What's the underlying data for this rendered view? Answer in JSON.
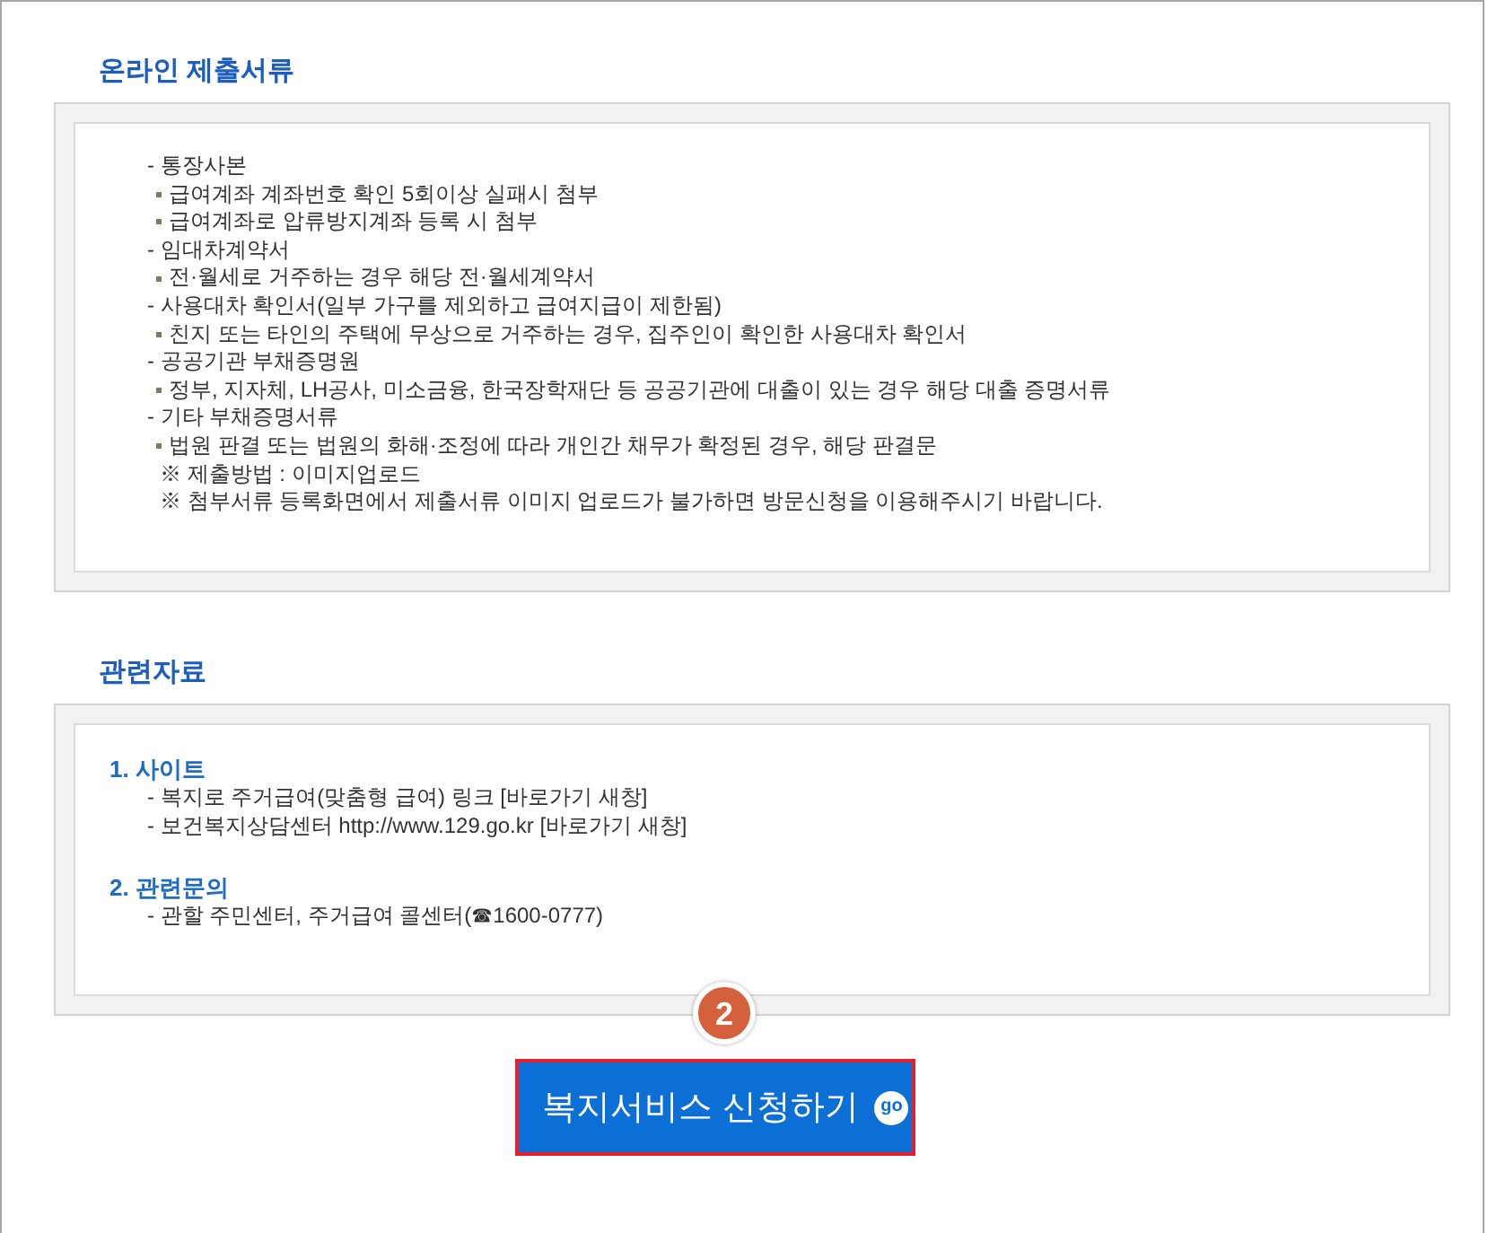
{
  "submission_documents": {
    "title": "온라인 제출서류",
    "lines": [
      {
        "kind": "heading",
        "text": "- 통장사본"
      },
      {
        "kind": "bullet",
        "text": "급여계좌 계좌번호 확인 5회이상 실패시 첨부"
      },
      {
        "kind": "bullet",
        "text": "급여계좌로 압류방지계좌 등록 시 첨부"
      },
      {
        "kind": "heading",
        "text": "- 임대차계약서"
      },
      {
        "kind": "bullet",
        "text": "전·월세로 거주하는 경우 해당 전·월세계약서"
      },
      {
        "kind": "heading",
        "text": "- 사용대차 확인서(일부 가구를 제외하고 급여지급이 제한됨)"
      },
      {
        "kind": "bullet",
        "text": "친지 또는 타인의 주택에 무상으로 거주하는 경우, 집주인이 확인한 사용대차 확인서"
      },
      {
        "kind": "heading",
        "text": "- 공공기관 부채증명원"
      },
      {
        "kind": "bullet",
        "text": "정부, 지자체, LH공사, 미소금융, 한국장학재단 등 공공기관에 대출이 있는 경우 해당 대출 증명서류"
      },
      {
        "kind": "heading",
        "text": "- 기타 부채증명서류"
      },
      {
        "kind": "bullet",
        "text": "법원 판결 또는 법원의 화해·조정에 따라 개인간 채무가 확정된 경우, 해당 판결문"
      },
      {
        "kind": "note",
        "text": "※ 제출방법 : 이미지업로드"
      },
      {
        "kind": "note",
        "text": "※ 첨부서류 등록화면에서 제출서류 이미지 업로드가 불가하면 방문신청을 이용해주시기 바랍니다."
      }
    ]
  },
  "related_materials": {
    "title": "관련자료",
    "groups": [
      {
        "heading": "1. 사이트",
        "items": [
          "- 복지로 주거급여(맞춤형 급여) 링크 [바로가기 새창]",
          "- 보건복지상담센터 http://www.129.go.kr [바로가기 새창]"
        ]
      },
      {
        "heading": "2. 관련문의",
        "items": [
          "- 관할 주민센터, 주거급여 콜센터(☎1600-0777)"
        ]
      }
    ]
  },
  "step_badge": "2",
  "apply_button": {
    "label": "복지서비스 신청하기",
    "badge": "go"
  }
}
